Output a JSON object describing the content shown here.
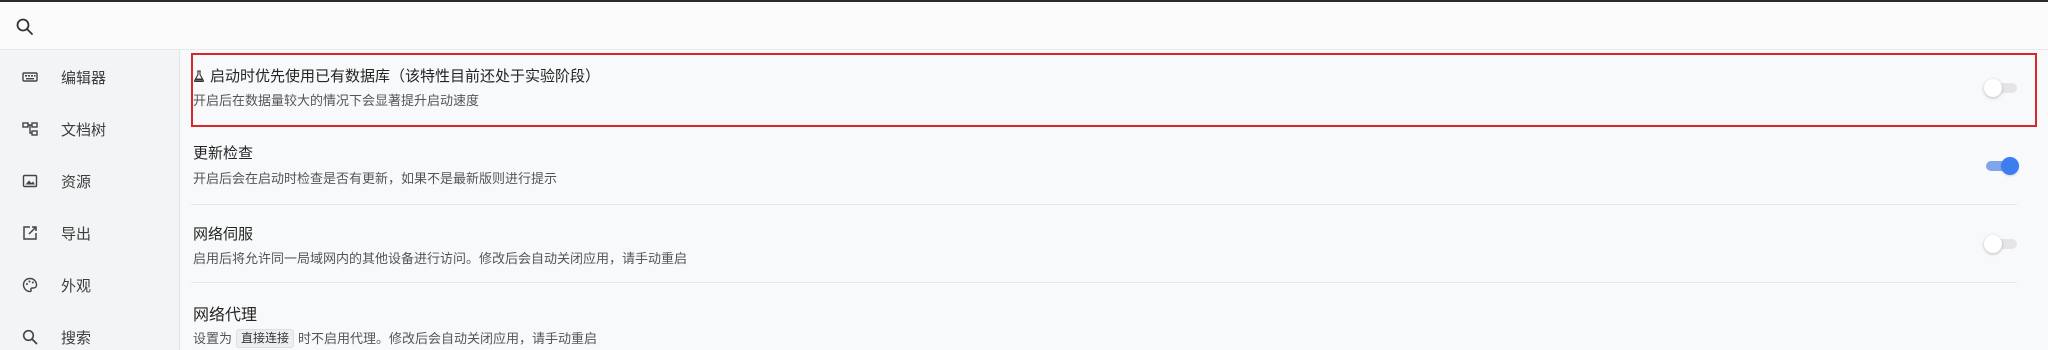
{
  "search": {
    "value": "",
    "placeholder": ""
  },
  "sidebar": {
    "items": [
      {
        "label": "编辑器",
        "icon": "keyboard-icon"
      },
      {
        "label": "文档树",
        "icon": "tree-icon"
      },
      {
        "label": "资源",
        "icon": "image-icon"
      },
      {
        "label": "导出",
        "icon": "export-icon"
      },
      {
        "label": "外观",
        "icon": "palette-icon"
      },
      {
        "label": "搜索",
        "icon": "search-icon"
      }
    ]
  },
  "settings": {
    "existing_db": {
      "title": "启动时优先使用已有数据库（该特性目前还处于实验阶段）",
      "desc": "开启后在数据量较大的情况下会显著提升启动速度",
      "enabled": false
    },
    "update_check": {
      "title": "更新检查",
      "desc": "开启后会在启动时检查是否有更新，如果不是最新版则进行提示",
      "enabled": true
    },
    "network_serve": {
      "title": "网络伺服",
      "desc": "启用后将允许同一局域网内的其他设备进行访问。修改后会自动关闭应用，请手动重启",
      "enabled": false
    },
    "network_proxy": {
      "title": "网络代理",
      "desc_prefix": "设置为",
      "desc_chip": "直接连接",
      "desc_suffix": "时不启用代理。修改后会自动关闭应用，请手动重启"
    }
  },
  "colors": {
    "highlight_border": "#d7262c",
    "toggle_on": "#3e7df0"
  }
}
